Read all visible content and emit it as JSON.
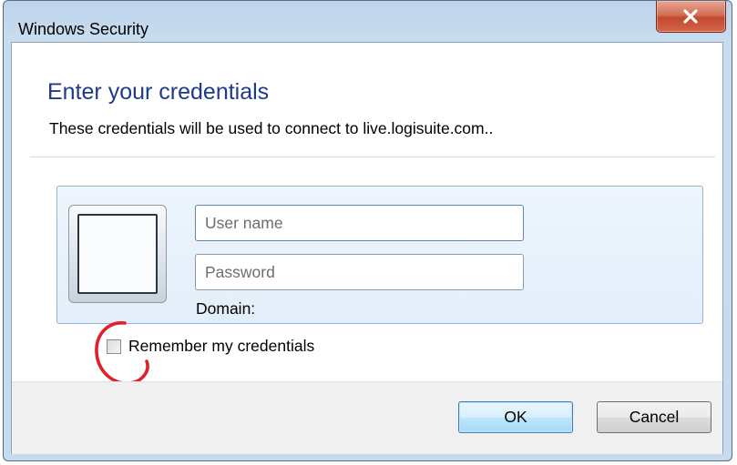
{
  "window": {
    "title": "Windows Security",
    "close_icon": "close-icon"
  },
  "dialog": {
    "heading": "Enter your credentials",
    "subtext": "These credentials will be used to connect to live.logisuite.com..",
    "user_tile_icon": "user-tile-icon"
  },
  "form": {
    "username_placeholder": "User name",
    "username_value": "",
    "password_placeholder": "Password",
    "password_value": "",
    "domain_label": "Domain:",
    "remember_label": "Remember my credentials",
    "remember_checked": false
  },
  "buttons": {
    "ok": "OK",
    "cancel": "Cancel"
  },
  "colors": {
    "heading": "#1e3a8c",
    "annotation_circle": "#e0202a",
    "close_button": "#c24a2e"
  }
}
